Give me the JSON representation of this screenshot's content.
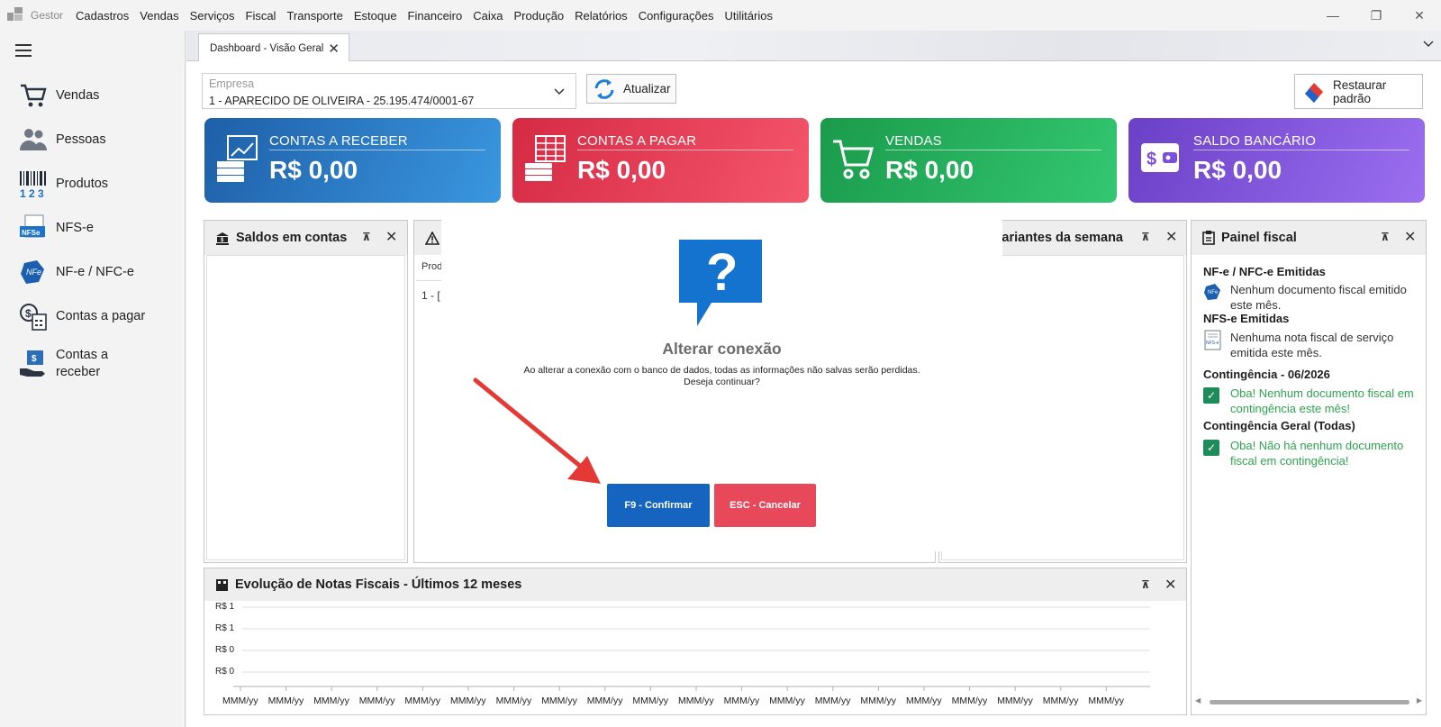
{
  "app": {
    "name": "Gestor"
  },
  "menu": [
    "Cadastros",
    "Vendas",
    "Serviços",
    "Fiscal",
    "Transporte",
    "Estoque",
    "Financeiro",
    "Caixa",
    "Produção",
    "Relatórios",
    "Configurações",
    "Utilitários"
  ],
  "window_controls": {
    "minimize": "—",
    "restore": "❐",
    "close": "✕"
  },
  "sidebar": {
    "items": [
      {
        "label": "Vendas",
        "icon": "cart-icon"
      },
      {
        "label": "Pessoas",
        "icon": "people-icon"
      },
      {
        "label": "Produtos",
        "icon": "barcode-icon"
      },
      {
        "label": "NFS-e",
        "icon": "nfse-icon"
      },
      {
        "label": "NF-e / NFC-e",
        "icon": "nfe-icon"
      },
      {
        "label": "Contas a pagar",
        "icon": "calculator-icon"
      },
      {
        "label": "Contas a\nreceber",
        "icon": "money-hand-icon"
      }
    ]
  },
  "tabs": [
    {
      "label": "Dashboard - Visão Geral",
      "close": "✕"
    }
  ],
  "empresa": {
    "label": "Empresa",
    "value": "1 - APARECIDO DE OLIVEIRA - 25.195.474/0001-67"
  },
  "toolbar": {
    "atualizar": "Atualizar",
    "restaurar": "Restaurar padrão"
  },
  "cards": [
    {
      "title": "CONTAS A RECEBER",
      "value": "R$ 0,00",
      "color_from": "#1e5fa8",
      "color_to": "#3a97e0"
    },
    {
      "title": "CONTAS A PAGAR",
      "value": "R$ 0,00",
      "color_from": "#d62a44",
      "color_to": "#f4566b"
    },
    {
      "title": "VENDAS",
      "value": "R$ 0,00",
      "color_from": "#1a9b4b",
      "color_to": "#34c772"
    },
    {
      "title": "SALDO BANCÁRIO",
      "value": "R$ 0,00",
      "color_from": "#6a40c7",
      "color_to": "#9c6ff0"
    }
  ],
  "panels": {
    "saldos": {
      "title": "Saldos em contas"
    },
    "middle": {
      "header_partial": "Prod",
      "row_partial": "1 - ["
    },
    "aniversariantes": {
      "title": "ersariantes da semana"
    },
    "painel_fiscal": {
      "title": "Painel fiscal",
      "nfe_heading": "NF-e / NFC-e Emitidas",
      "nfe_text": "Nenhum documento fiscal emitido este mês.",
      "nfse_heading": "NFS-e Emitidas",
      "nfse_text": "Nenhuma nota fiscal de serviço emitida este mês.",
      "cont_heading": "Contingência - 06/2026",
      "cont_text": "Oba! Nenhum documento fiscal em contingência este mês!",
      "contg_heading": "Contingência Geral (Todas)",
      "contg_text": "Oba! Não há nenhum documento fiscal em contingência!"
    },
    "evolucao": {
      "title": "Evolução de Notas Fiscais - Últimos 12 meses"
    }
  },
  "modal": {
    "title": "Alterar conexão",
    "message_line1": "Ao alterar a conexão com o banco de dados, todas as informações não salvas serão perdidas.",
    "message_line2": "Deseja continuar?",
    "confirm": "F9 - Confirmar",
    "cancel": "ESC - Cancelar"
  },
  "chart_data": {
    "type": "line",
    "title": "Evolução de Notas Fiscais - Últimos 12 meses",
    "y_tick_labels": [
      "R$ 1",
      "R$ 1",
      "R$ 0",
      "R$ 0"
    ],
    "x_tick_labels": [
      "MMM/yy",
      "MMM/yy",
      "MMM/yy",
      "MMM/yy",
      "MMM/yy",
      "MMM/yy",
      "MMM/yy",
      "MMM/yy",
      "MMM/yy",
      "MMM/yy",
      "MMM/yy",
      "MMM/yy",
      "MMM/yy",
      "MMM/yy",
      "MMM/yy",
      "MMM/yy",
      "MMM/yy",
      "MMM/yy",
      "MMM/yy",
      "MMM/yy"
    ],
    "series": [],
    "grid": true
  }
}
